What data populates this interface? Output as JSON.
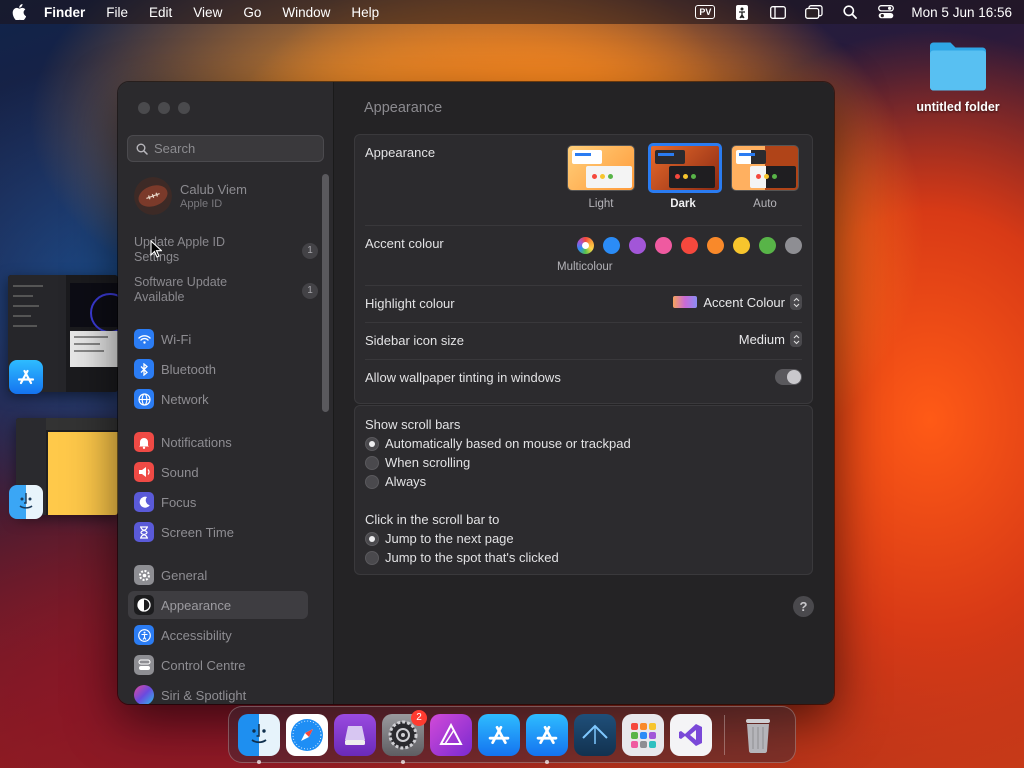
{
  "menubar": {
    "app": "Finder",
    "items": [
      "File",
      "Edit",
      "View",
      "Go",
      "Window",
      "Help"
    ],
    "input_source": "PV",
    "clock": "Mon 5 Jun  16:56"
  },
  "desktop": {
    "folder_label": "untitled folder"
  },
  "window": {
    "search_placeholder": "Search",
    "account": {
      "name": "Calub Viem",
      "sub": "Apple ID"
    },
    "notices": [
      {
        "label": "Update Apple ID Settings",
        "count": "1"
      },
      {
        "label": "Software Update Available",
        "count": "1"
      }
    ],
    "sidebar_groups": [
      [
        {
          "label": "Wi-Fi",
          "icon": "wifi-icon",
          "color": "#2b7cf3"
        },
        {
          "label": "Bluetooth",
          "icon": "bluetooth-icon",
          "color": "#2b7cf3"
        },
        {
          "label": "Network",
          "icon": "globe-icon",
          "color": "#2b7cf3"
        }
      ],
      [
        {
          "label": "Notifications",
          "icon": "bell-icon",
          "color": "#ef4a45"
        },
        {
          "label": "Sound",
          "icon": "speaker-icon",
          "color": "#ef4a45"
        },
        {
          "label": "Focus",
          "icon": "moon-icon",
          "color": "#5a5ad8"
        },
        {
          "label": "Screen Time",
          "icon": "hourglass-icon",
          "color": "#5a5ad8"
        }
      ],
      [
        {
          "label": "General",
          "icon": "gear-icon",
          "color": "#8e8e93"
        },
        {
          "label": "Appearance",
          "icon": "appearance-icon",
          "color": "#1c1c1e",
          "selected": true
        },
        {
          "label": "Accessibility",
          "icon": "accessibility-icon",
          "color": "#2b7cf3"
        },
        {
          "label": "Control Centre",
          "icon": "control-centre-icon",
          "color": "#8e8e93"
        },
        {
          "label": "Siri & Spotlight",
          "icon": "siri-icon",
          "color": "#c04ad8"
        }
      ]
    ],
    "content_title": "Appearance",
    "appearance": {
      "label": "Appearance",
      "options": [
        {
          "label": "Light",
          "selected": false
        },
        {
          "label": "Dark",
          "selected": true
        },
        {
          "label": "Auto",
          "selected": false
        }
      ]
    },
    "accent": {
      "label": "Accent colour",
      "caption": "Multicolour",
      "colors": [
        "multicolour",
        "#2b8cf6",
        "#a256d8",
        "#ef5aa0",
        "#f5483d",
        "#f9892a",
        "#f7c52d",
        "#58b448",
        "#8e8e93"
      ]
    },
    "highlight": {
      "label": "Highlight colour",
      "value": "Accent Colour"
    },
    "sidebar_icon_size": {
      "label": "Sidebar icon size",
      "value": "Medium"
    },
    "tinting": {
      "label": "Allow wallpaper tinting in windows",
      "on": true
    },
    "scroll_bars": {
      "label": "Show scroll bars",
      "options": [
        "Automatically based on mouse or trackpad",
        "When scrolling",
        "Always"
      ],
      "selected": 0
    },
    "click_scroll": {
      "label": "Click in the scroll bar to",
      "options": [
        "Jump to the next page",
        "Jump to the spot that's clicked"
      ],
      "selected": 0
    },
    "help": "?"
  },
  "dock": {
    "apps": [
      "Finder",
      "Safari",
      "Disk Utility",
      "System Settings",
      "Affinity Designer",
      "App Store",
      "Xcode Instruments",
      "Unknown",
      "Launchpad",
      "Visual Studio"
    ],
    "settings_badge": "2"
  },
  "colors": {
    "accent_blue": "#2a7cf2",
    "window_bg": "#242325",
    "sidebar_bg": "#2b2a2d"
  }
}
